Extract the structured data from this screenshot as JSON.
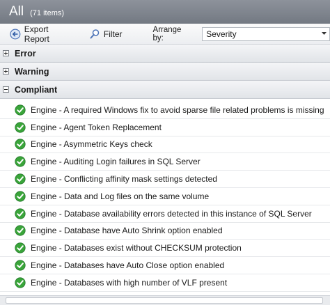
{
  "header": {
    "title": "All",
    "count": "(71 items)"
  },
  "toolbar": {
    "export_label": "Export Report",
    "export_icon": "export-report-icon",
    "filter_label": "Filter",
    "filter_icon": "filter-icon",
    "arrange_label": "Arrange by:",
    "arrange_value": "Severity"
  },
  "groups": [
    {
      "label": "Error",
      "state": "collapsed"
    },
    {
      "label": "Warning",
      "state": "collapsed"
    },
    {
      "label": "Compliant",
      "state": "expanded"
    }
  ],
  "status_color": "#3aa53a",
  "items": [
    "Engine - A required Windows fix to avoid sparse file related problems is missing",
    "Engine - Agent Token Replacement",
    "Engine - Asymmetric Keys check",
    "Engine - Auditing Login failures in SQL Server",
    "Engine - Conflicting affinity mask settings detected",
    "Engine - Data and Log files on the same volume",
    "Engine - Database availability errors detected in this instance of SQL Server",
    "Engine - Database have Auto Shrink option enabled",
    "Engine - Databases exist without CHECKSUM protection",
    "Engine - Databases have Auto Close option enabled",
    "Engine - Databases with high number of VLF present"
  ]
}
